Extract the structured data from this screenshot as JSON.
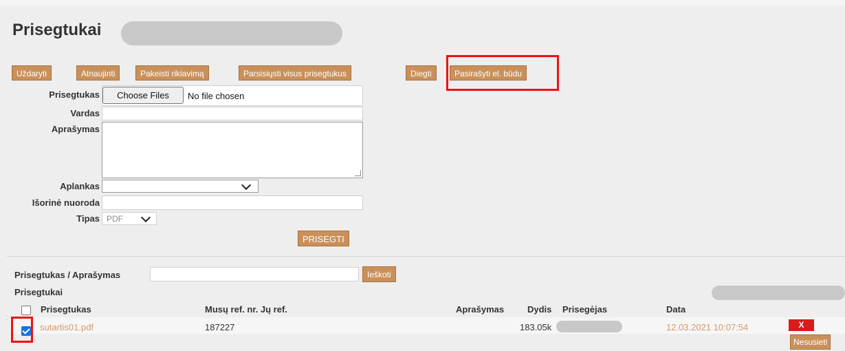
{
  "page": {
    "title": "Prisegtukai"
  },
  "toolbar": {
    "close": "Uždaryti",
    "refresh": "Atnaujinti",
    "change_order": "Pakeisti rikiavimą",
    "download_all": "Parsisiųsti visus prisegtukus",
    "diegti": "Diegti",
    "sign": "Pasirašyti el. būdu"
  },
  "form": {
    "attachment_label": "Prisegtukas",
    "choose_files": "Choose Files",
    "no_file": "No file chosen",
    "name_label": "Vardas",
    "description_label": "Aprašymas",
    "folder_label": "Aplankas",
    "external_link_label": "Išorinė nuoroda",
    "type_label": "Tipas",
    "type_value": "PDF",
    "attach_button": "PRISEGTI"
  },
  "search": {
    "label": "Prisegtukas / Aprašymas",
    "button": "Ieškoti"
  },
  "list": {
    "heading": "Prisegtukai",
    "columns": {
      "attachment": "Prisegtukas",
      "our_ref": "Musų ref. nr. Jų ref.",
      "description": "Aprašymas",
      "size": "Dydis",
      "attacher": "Prisegėjas",
      "date": "Data"
    },
    "rows": [
      {
        "file": "sutartis01.pdf",
        "our_ref": "187227",
        "size": "183.05k",
        "date": "12.03.2021 10:07:54",
        "delete": "X",
        "unlink": "Nesusieti",
        "checked": true
      }
    ]
  },
  "colors": {
    "button": "#c9905a",
    "highlight": "#ee1111",
    "link": "#d49a70",
    "delete": "#d81b1b"
  }
}
